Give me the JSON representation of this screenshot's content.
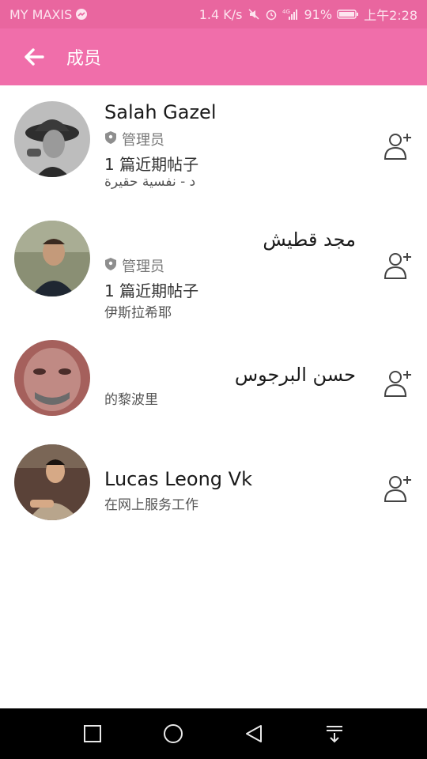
{
  "status_bar": {
    "carrier": "MY MAXIS",
    "speed": "1.4 K/s",
    "network": "4G",
    "battery": "91%",
    "time": "上午2:28"
  },
  "app_bar": {
    "title": "成员",
    "back_icon": "arrow-left-icon"
  },
  "members": [
    {
      "name": "Salah Gazel",
      "role": "管理员",
      "posts": "1 篇近期帖子",
      "info": "د - نفسية حقيرة",
      "add_icon": "add-friend-icon"
    },
    {
      "name": "مجد قطيش",
      "role": "管理员",
      "posts": "1 篇近期帖子",
      "info": "伊斯拉希耶",
      "add_icon": "add-friend-icon"
    },
    {
      "name": "حسن البرجوس",
      "info": "的黎波里",
      "add_icon": "add-friend-icon"
    },
    {
      "name": "Lucas Leong Vk",
      "info": "在网上服务工作",
      "add_icon": "add-friend-icon"
    }
  ],
  "nav_bar": {
    "icons": [
      "square-icon",
      "circle-icon",
      "triangle-back-icon",
      "notification-pull-icon"
    ]
  },
  "colors": {
    "status_bar": "#e9669f",
    "app_bar": "#f06eaa",
    "nav_bar": "#000000"
  }
}
